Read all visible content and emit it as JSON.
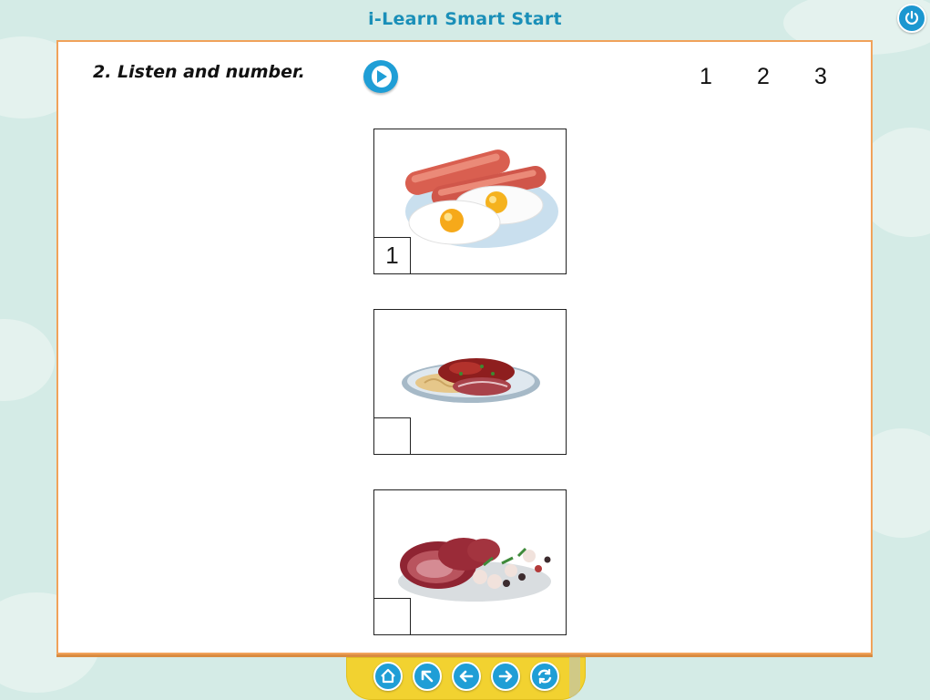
{
  "app": {
    "title": "i-Learn Smart Start"
  },
  "exercise": {
    "instruction": "2. Listen and number.",
    "answer_options": [
      "1",
      "2",
      "3"
    ],
    "pictures": [
      {
        "image": "sausages-and-fried-eggs",
        "number": "1"
      },
      {
        "image": "spaghetti-with-meat",
        "number": ""
      },
      {
        "image": "sliced-steak-with-vegetables",
        "number": ""
      }
    ]
  },
  "icons": {
    "power": "power-icon",
    "play": "play-icon",
    "home": "home-icon",
    "back_to_start": "arrow-up-left-icon",
    "previous": "arrow-left-icon",
    "next": "arrow-right-icon",
    "reload": "reload-icon"
  },
  "colors": {
    "background": "#d4ebe6",
    "title": "#1a8fb8",
    "panel_border": "#f0a25a",
    "accent_blue": "#1f9ed6",
    "nav_bar": "#f2d230"
  }
}
